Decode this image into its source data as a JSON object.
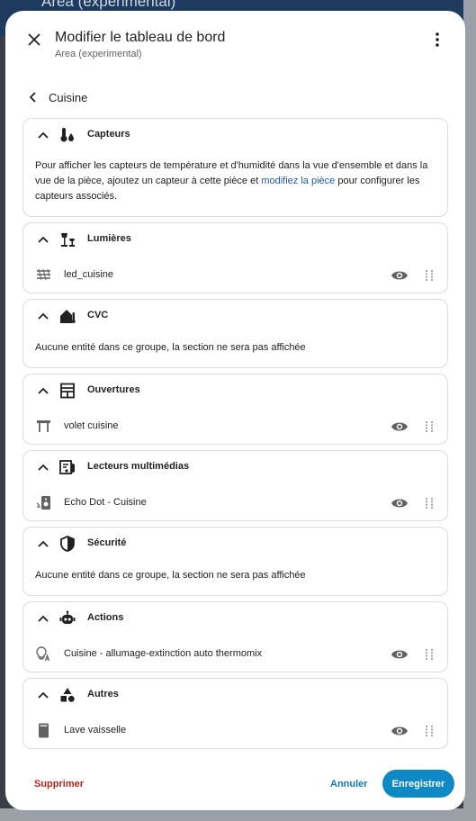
{
  "background": {
    "title": "Area (experimental)"
  },
  "dialog": {
    "title": "Modifier le tableau de bord",
    "subtitle": "Area (experimental)",
    "area_name": "Cuisine"
  },
  "sections": {
    "capteurs": {
      "title": "Capteurs",
      "text_before": "Pour afficher les capteurs de température et d'humidité dans la vue d'ensemble et dans la vue de la pièce, ajoutez un capteur à cette pièce et ",
      "link": "modifiez la pièce",
      "text_after": " pour configurer les capteurs associés."
    },
    "lumieres": {
      "title": "Lumières",
      "entities": [
        {
          "name": "led_cuisine",
          "icon": "led-strip-icon"
        }
      ]
    },
    "cvc": {
      "title": "CVC",
      "empty": "Aucune entité dans ce groupe, la section ne sera pas affichée"
    },
    "ouvertures": {
      "title": "Ouvertures",
      "entities": [
        {
          "name": "volet cuisine",
          "icon": "shutter-icon"
        }
      ]
    },
    "lecteurs": {
      "title": "Lecteurs multimédias",
      "entities": [
        {
          "name": "Echo Dot - Cuisine",
          "icon": "speaker-wireless-icon"
        }
      ]
    },
    "securite": {
      "title": "Sécurité",
      "empty": "Aucune entité dans ce groupe, la section ne sera pas affichée"
    },
    "actions": {
      "title": "Actions",
      "entities": [
        {
          "name": "Cuisine - allumage-extinction auto thermomix",
          "icon": "lightbulb-auto-icon"
        }
      ]
    },
    "autres": {
      "title": "Autres",
      "entities": [
        {
          "name": "Lave vaisselle",
          "icon": "dishwasher-icon"
        }
      ]
    }
  },
  "footer": {
    "delete_label": "Supprimer",
    "cancel_label": "Annuler",
    "save_label": "Enregistrer"
  },
  "colors": {
    "accent": "#0e89c4",
    "danger": "#b3261e",
    "link": "#1f5aa3"
  }
}
